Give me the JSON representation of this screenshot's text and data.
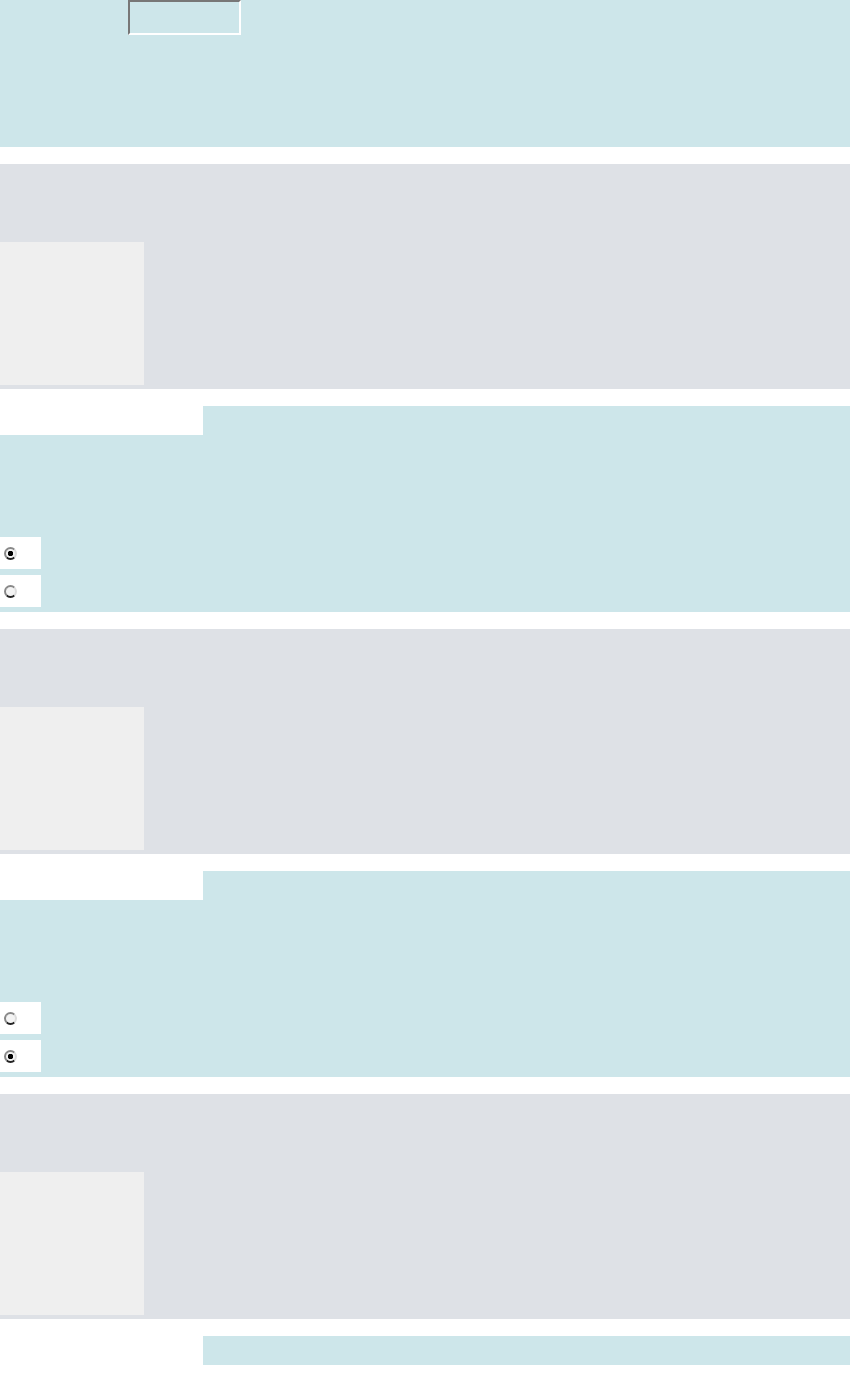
{
  "sections": [
    {
      "kind": "entry"
    },
    {
      "kind": "panel"
    },
    {
      "kind": "choice",
      "options": [
        {
          "selected": true
        },
        {
          "selected": false
        }
      ]
    },
    {
      "kind": "panel"
    },
    {
      "kind": "choice",
      "options": [
        {
          "selected": false
        },
        {
          "selected": true
        }
      ]
    },
    {
      "kind": "panel"
    },
    {
      "kind": "tail"
    }
  ]
}
